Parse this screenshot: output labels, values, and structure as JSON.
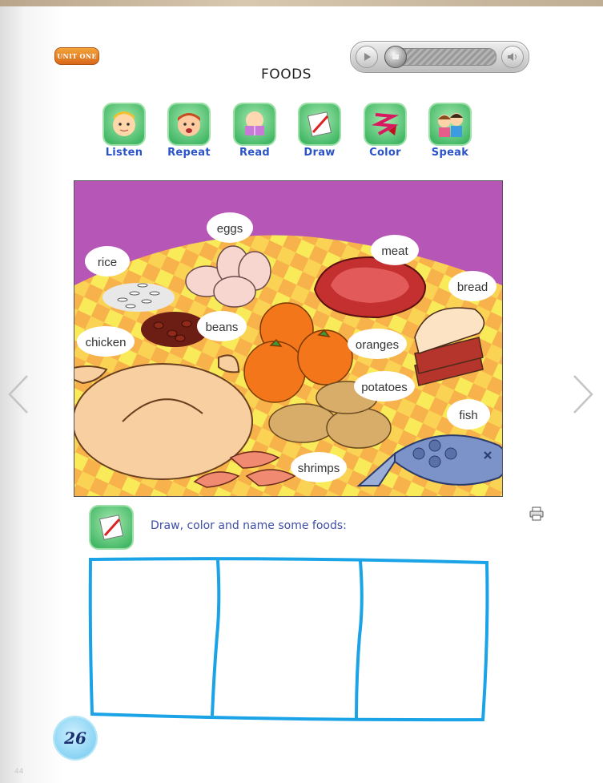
{
  "unit_badge": "UNIT ONE",
  "title": "FOODS",
  "audio": {
    "play_icon": "play-icon",
    "stop_icon": "stop-icon",
    "volume_icon": "volume-icon",
    "progress": 0
  },
  "activities": [
    {
      "label": "Listen",
      "icon": "listen-icon"
    },
    {
      "label": "Repeat",
      "icon": "repeat-icon"
    },
    {
      "label": "Read",
      "icon": "read-icon"
    },
    {
      "label": "Draw",
      "icon": "draw-icon"
    },
    {
      "label": "Color",
      "icon": "color-icon"
    },
    {
      "label": "Speak",
      "icon": "speak-icon"
    }
  ],
  "foods": {
    "eggs": "eggs",
    "meat": "meat",
    "rice": "rice",
    "bread": "bread",
    "beans": "beans",
    "chicken": "chicken",
    "oranges": "oranges",
    "potatoes": "potatoes",
    "fish": "fish",
    "shrimps": "shrimps"
  },
  "instruction": "Draw, color and name some foods:",
  "page_number": "26",
  "corner_number": "44",
  "colors": {
    "accent_blue": "#2a53c9",
    "box_blue": "#1aa3e6",
    "icon_green": "#2fae57",
    "badge_orange": "#e4792a",
    "tablecloth_yellow": "#f6e24a",
    "wall_purple": "#b45ab7"
  }
}
